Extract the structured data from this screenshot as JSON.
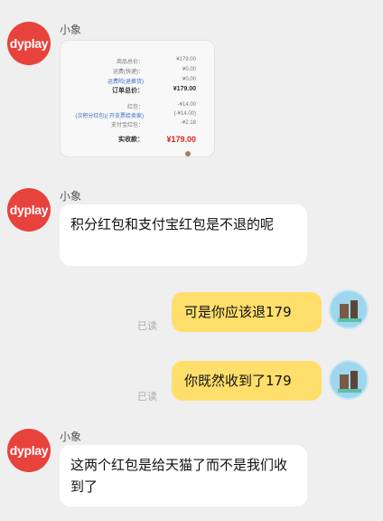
{
  "contact": {
    "name": "小象",
    "avatar_text": "dyplay"
  },
  "receipt": {
    "rows": [
      {
        "label": "商品总价：",
        "value": "¥179.00"
      },
      {
        "label": "运费(快递)：",
        "value": "¥0.00"
      },
      {
        "label": "运费险(退换货)",
        "value": "¥0.00"
      },
      {
        "label": "订单总价：",
        "value": "¥179.00"
      },
      {
        "label": "红包：",
        "value": "-¥14.00"
      },
      {
        "label": "(次积分红包)( 开支票给卖家)",
        "value": "(-¥14.00)"
      },
      {
        "label": "支付宝红包：",
        "value": "-¥2.18"
      },
      {
        "label": "实收款：",
        "value": "¥179.00"
      }
    ]
  },
  "messages": [
    {
      "text": "积分红包和支付宝红包是不退的呢"
    },
    {
      "text": "可是你应该退179",
      "status": "已读"
    },
    {
      "text": "你既然收到了179",
      "status": "已读"
    },
    {
      "text": "这两个红包是给天猫了而不是我们收到了"
    }
  ]
}
